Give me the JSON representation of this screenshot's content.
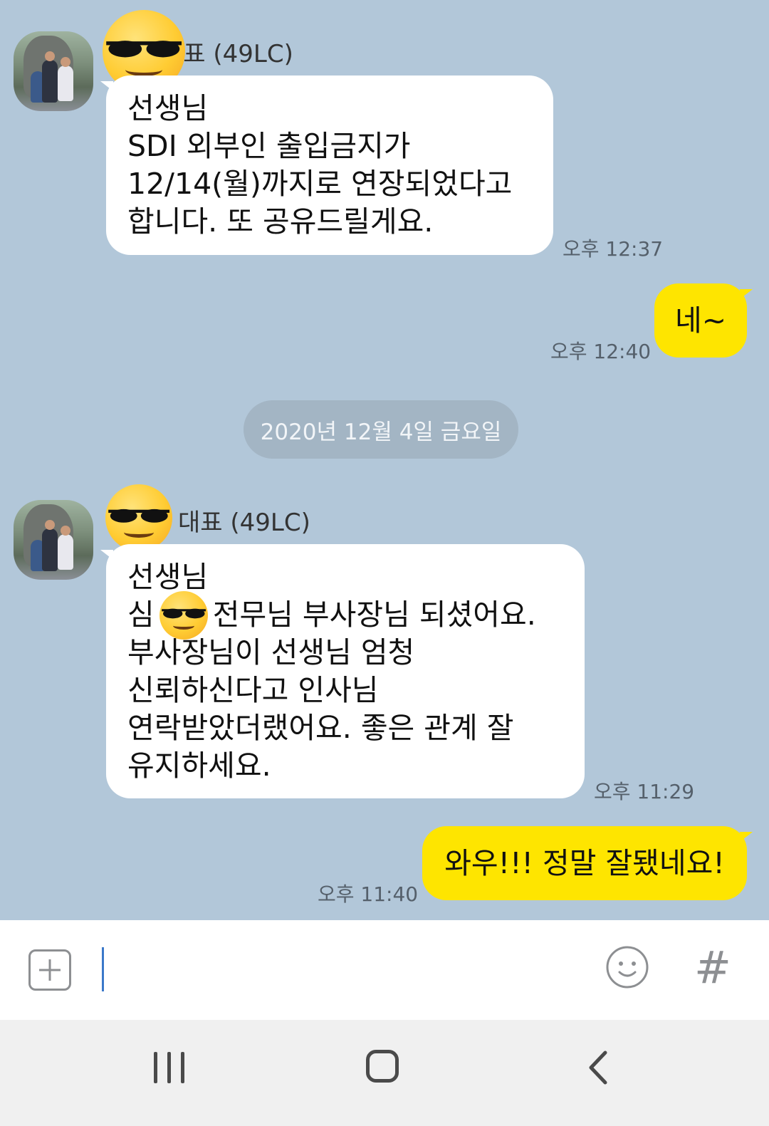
{
  "messages": [
    {
      "direction": "incoming",
      "sender": "대표 (49LC)",
      "lines": [
        "선생님",
        "SDI 외부인 출입금지가",
        "12/14(월)까지로 연장되었다고",
        "합니다. 또 공유드릴게요."
      ],
      "time": "오후 12:37"
    },
    {
      "direction": "outgoing",
      "lines": [
        "네~"
      ],
      "time": "오후 12:40"
    },
    {
      "type": "date_divider",
      "text": "2020년 12월 4일 금요일"
    },
    {
      "direction": "incoming",
      "sender": "대표 (49LC)",
      "lines": [
        "선생님",
        "심",
        "전무님 부사장님 되셨어요.",
        "부사장님이 선생님 엄청",
        "신뢰하신다고 인사님",
        "연락받았더랬어요. 좋은 관계 잘",
        "유지하세요."
      ],
      "time": "오후 11:29"
    },
    {
      "direction": "outgoing",
      "lines": [
        "와우!!! 정말 잘됐네요!"
      ],
      "time": "오후 11:40"
    }
  ],
  "input_bar": {
    "add_icon": "plus-square-icon",
    "emoticon_icon": "smiley-icon",
    "hash_label": "#"
  },
  "navigation": {
    "recents_icon": "recents-icon",
    "home_icon": "home-icon",
    "back_icon": "back-icon"
  },
  "colors": {
    "chat_background": "#b2c7d9",
    "outgoing_bubble": "#fee500",
    "incoming_bubble": "#ffffff",
    "date_pill": "#a3b5c4"
  }
}
